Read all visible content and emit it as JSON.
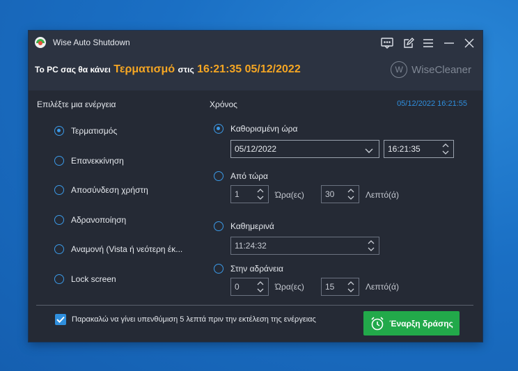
{
  "window": {
    "title": "Wise Auto Shutdown",
    "status_prefix": "Το PC σας θα κάνει",
    "status_action": "Τερματισμό",
    "status_mid": "στις",
    "status_time": "16:21:35 05/12/2022",
    "brand": "WiseCleaner",
    "brand_logo_letter": "W"
  },
  "titlebar_icons": [
    "feedback-icon",
    "edit-icon",
    "menu-icon",
    "minimize-icon",
    "close-icon"
  ],
  "actions": {
    "label": "Επιλέξτε μια ενέργεια",
    "items": [
      {
        "label": "Τερματισμός",
        "checked": true
      },
      {
        "label": "Επανεκκίνηση",
        "checked": false
      },
      {
        "label": "Αποσύνδεση χρήστη",
        "checked": false
      },
      {
        "label": "Αδρανοποίηση",
        "checked": false
      },
      {
        "label": "Αναμονή (Vista ή νεότερη έκ...",
        "checked": false
      },
      {
        "label": "Lock screen",
        "checked": false
      }
    ]
  },
  "time": {
    "label": "Χρόνος",
    "current_datetime": "05/12/2022 16:21:55",
    "scheduled": {
      "label": "Καθορισμένη ώρα",
      "checked": true,
      "date": "05/12/2022",
      "time": "16:21:35"
    },
    "from_now": {
      "label": "Από τώρα",
      "checked": false,
      "hours": "1",
      "hours_unit": "Ώρα(ες)",
      "minutes": "30",
      "minutes_unit": "Λεπτό(ά)"
    },
    "daily": {
      "label": "Καθημερινά",
      "checked": false,
      "time": "11:24:32"
    },
    "idle": {
      "label": "Στην αδράνεια",
      "checked": false,
      "hours": "0",
      "hours_unit": "Ώρα(ες)",
      "minutes": "15",
      "minutes_unit": "Λεπτό(ά)"
    }
  },
  "footer": {
    "reminder_checked": true,
    "reminder_text": "Παρακαλώ να γίνει υπενθύμιση 5 λεπτά πριν την εκτέλεση της ενέργειας",
    "start_button": "Έναρξη δράσης"
  },
  "colors": {
    "accent": "#2f8fde",
    "orange": "#f5a623",
    "green": "#22a94a",
    "window_bg": "#252a35",
    "header_bg": "#2c3341"
  }
}
